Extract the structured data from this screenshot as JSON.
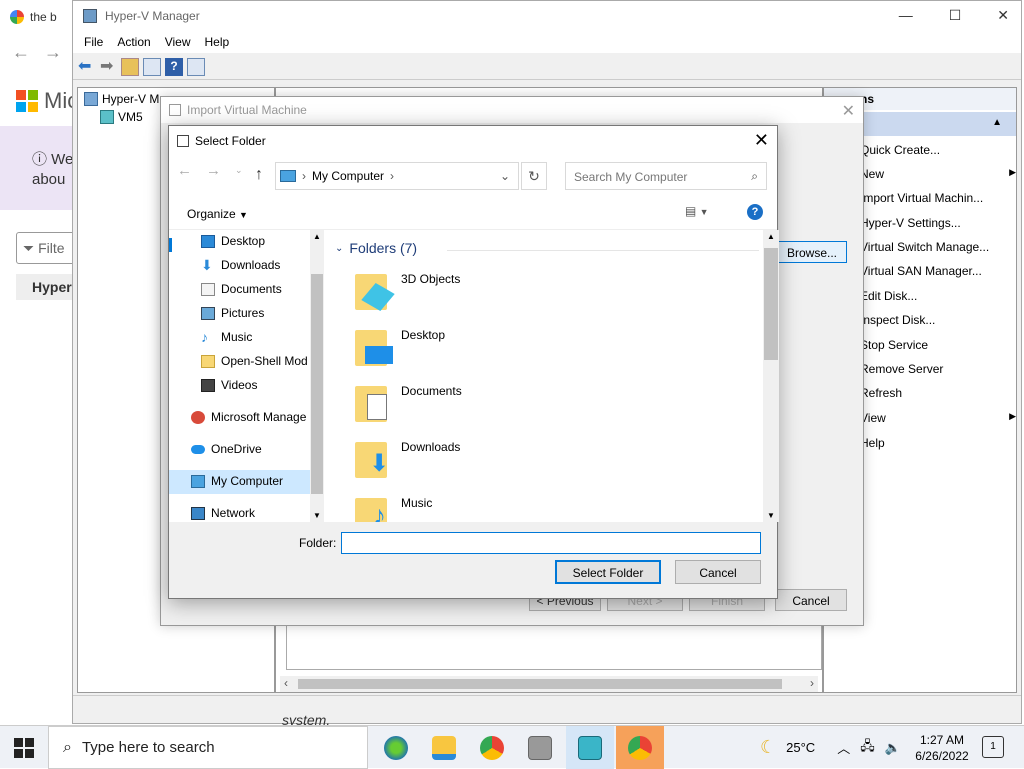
{
  "browser": {
    "tab_title": "the b",
    "ms_text": "Mic",
    "banner_text_1": "We",
    "banner_text_2": "abou",
    "filter_placeholder": "Filte",
    "hyper_label": "Hyper-"
  },
  "hyperv": {
    "title": "Hyper-V Manager",
    "menu": [
      "File",
      "Action",
      "Help"
    ],
    "menu_view": "View",
    "tree_root": "Hyper-V M",
    "tree_child": "VM5",
    "actions_header": "ns",
    "actions": [
      "Quick Create...",
      "New",
      "Import Virtual Machin...",
      "Hyper-V Settings...",
      "Virtual Switch Manage...",
      "Virtual SAN Manager...",
      "Edit Disk...",
      "Inspect Disk...",
      "Stop Service",
      "Remove Server",
      "Refresh",
      "View",
      "Help"
    ],
    "system_text": "system."
  },
  "import_dialog": {
    "title": "Import Virtual Machine",
    "browse": "Browse...",
    "previous": "< Previous",
    "next": "Next >",
    "finish": "Finish",
    "cancel": "Cancel"
  },
  "select_folder": {
    "title": "Select Folder",
    "address": "My Computer",
    "search_placeholder": "Search My Computer",
    "organize": "Organize",
    "nav_items": [
      {
        "label": "Desktop",
        "pinned": true
      },
      {
        "label": "Downloads",
        "pinned": true
      },
      {
        "label": "Documents",
        "pinned": true
      },
      {
        "label": "Pictures",
        "pinned": true
      },
      {
        "label": "Music",
        "pinned": false
      },
      {
        "label": "Open-Shell Mod",
        "pinned": false
      },
      {
        "label": "Videos",
        "pinned": false
      }
    ],
    "nav_roots": [
      "Microsoft Manage",
      "OneDrive",
      "My Computer",
      "Network"
    ],
    "folders_header": "Folders (7)",
    "folders": [
      "3D Objects",
      "Desktop",
      "Documents",
      "Downloads",
      "Music"
    ],
    "folder_label": "Folder:",
    "folder_value": "",
    "select_button": "Select Folder",
    "cancel_button": "Cancel"
  },
  "taskbar": {
    "search_placeholder": "Type here to search",
    "temperature": "25°C",
    "time": "1:27 AM",
    "date": "6/26/2022",
    "notification_count": "1"
  },
  "colors": {
    "accent": "#0078d7",
    "folder": "#f8d775",
    "selection": "#cde8ff"
  }
}
